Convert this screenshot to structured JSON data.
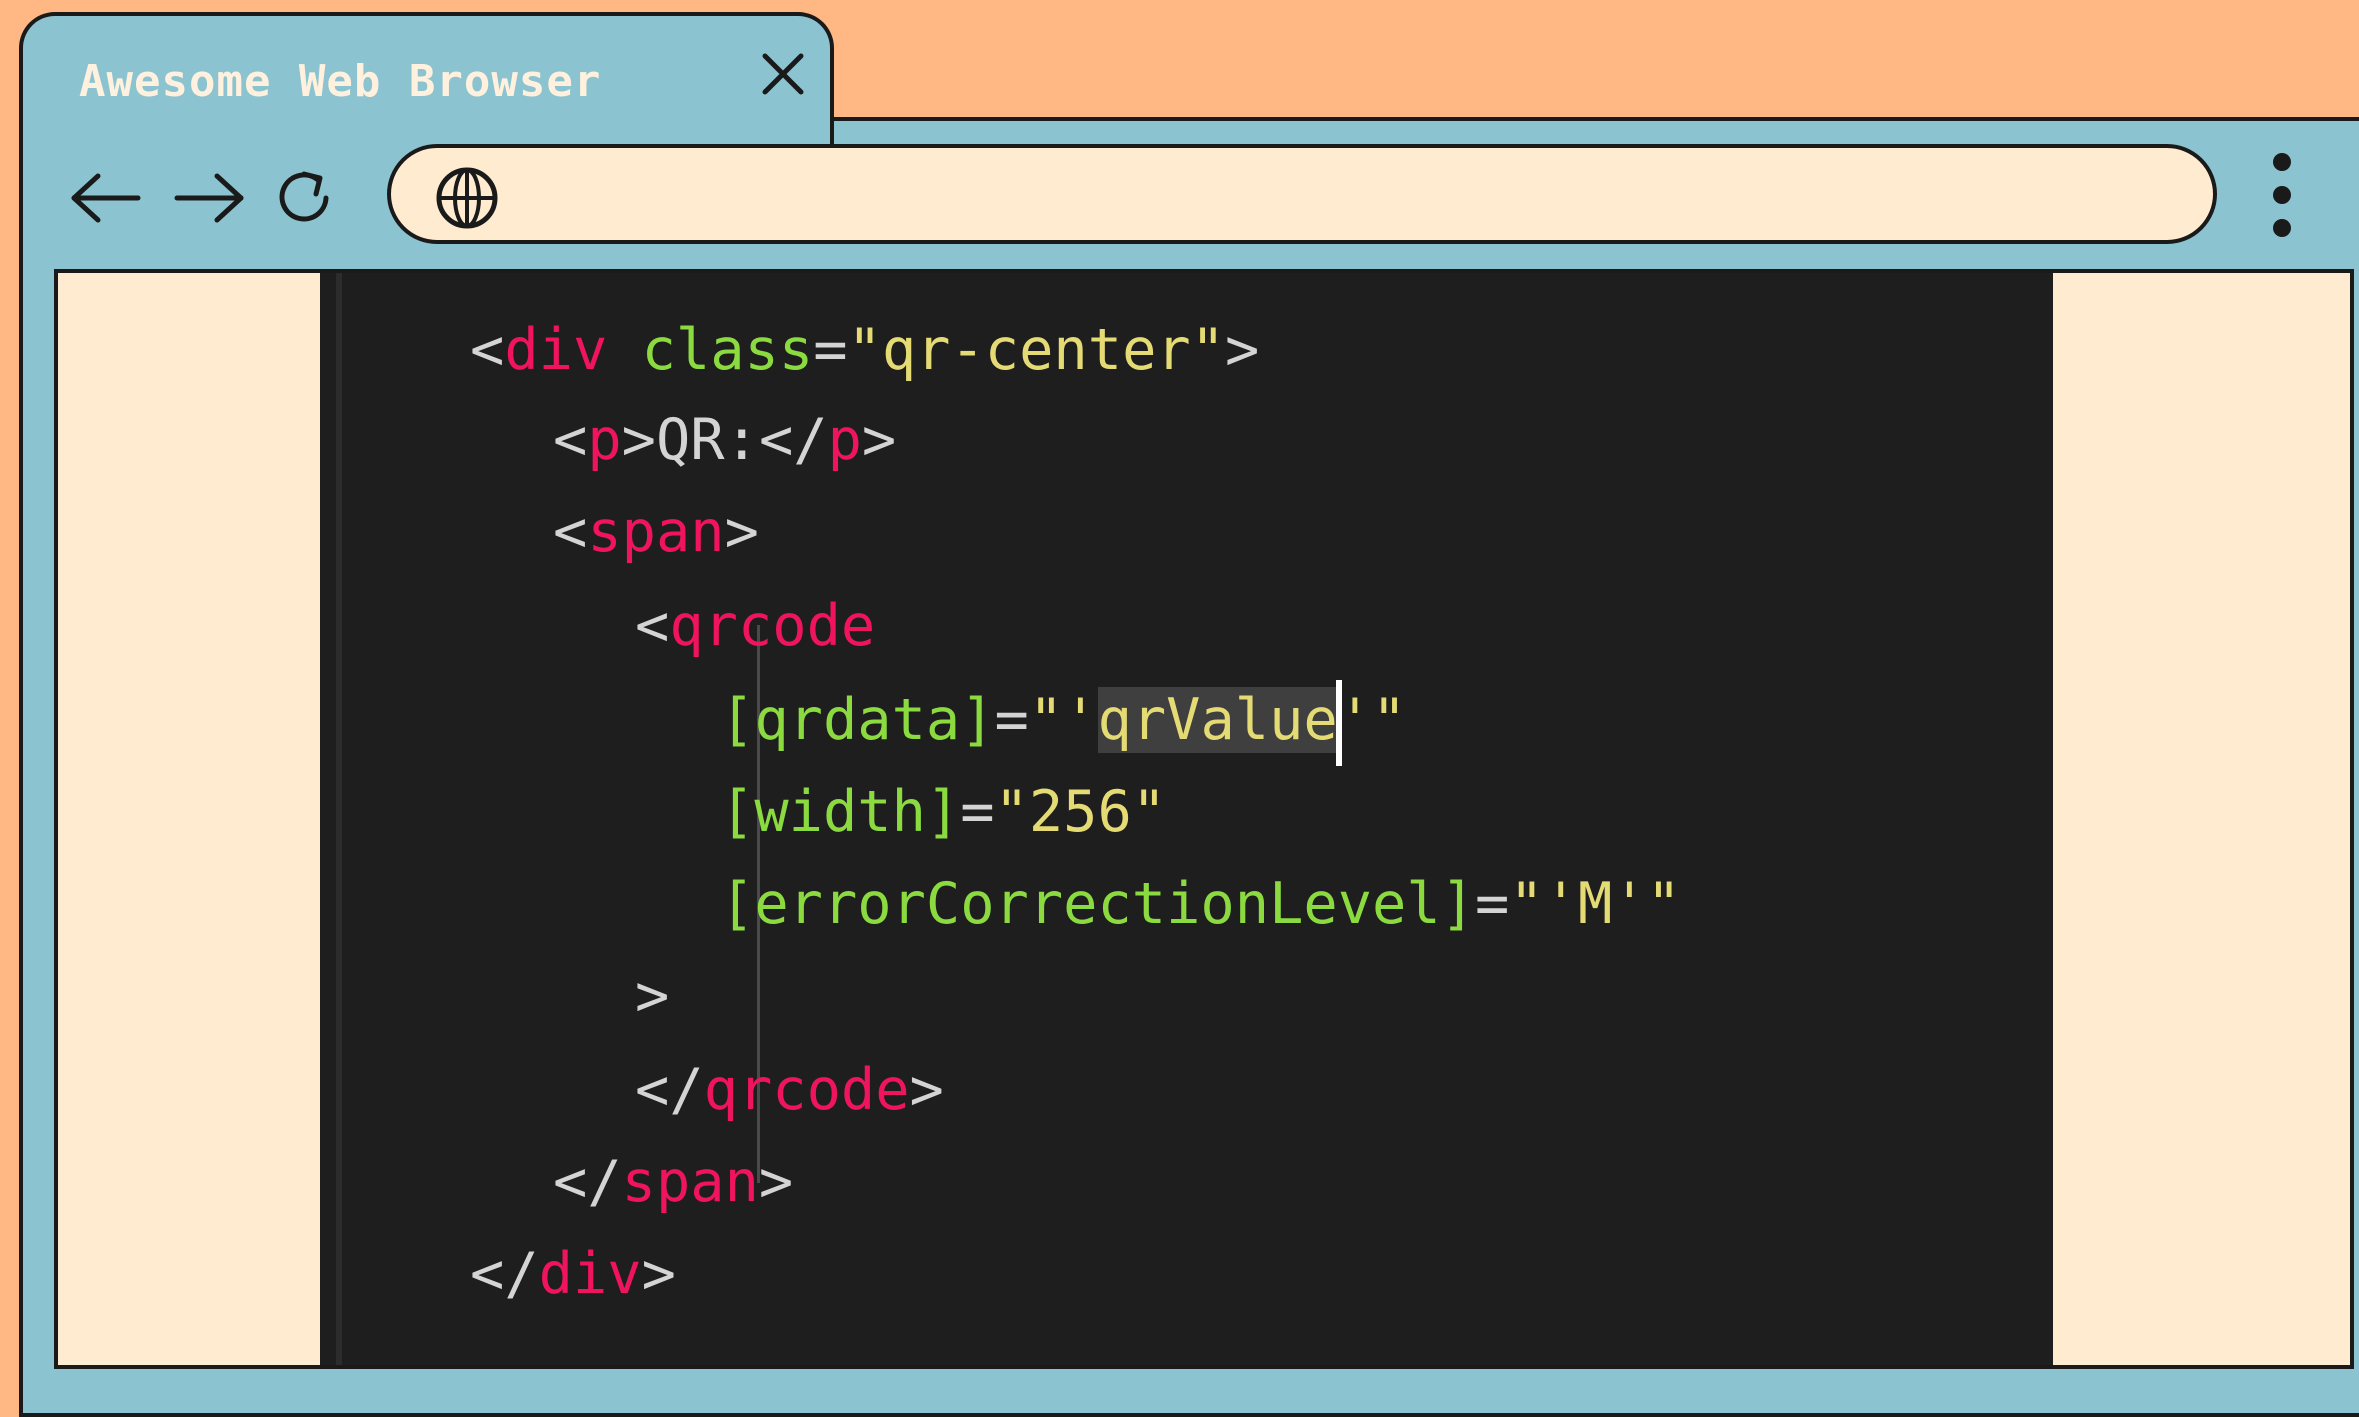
{
  "browser": {
    "tab_title": "Awesome Web Browser",
    "address_value": "",
    "icons": {
      "close": "close-icon",
      "back": "arrow-left-icon",
      "forward": "arrow-right-icon",
      "reload": "reload-icon",
      "globe": "globe-icon",
      "menu": "more-vertical-icon"
    }
  },
  "editor": {
    "lines": [
      {
        "parts": [
          [
            "<",
            "p"
          ],
          [
            "div",
            "t"
          ],
          [
            " ",
            "p"
          ],
          [
            "class",
            "a"
          ],
          [
            "=",
            "p"
          ],
          [
            "\"qr-center\"",
            "s"
          ],
          [
            ">",
            "p"
          ]
        ]
      },
      {
        "parts": [
          [
            "<",
            "p"
          ],
          [
            "p",
            "t"
          ],
          [
            ">",
            "p"
          ],
          [
            "QR:",
            "p"
          ],
          [
            "</",
            "p"
          ],
          [
            "p",
            "t"
          ],
          [
            ">",
            "p"
          ]
        ]
      },
      {
        "parts": [
          [
            "<",
            "p"
          ],
          [
            "span",
            "t"
          ],
          [
            ">",
            "p"
          ]
        ]
      },
      {
        "parts": [
          [
            "<",
            "p"
          ],
          [
            "qrcode",
            "t"
          ]
        ]
      },
      {
        "parts": [
          [
            "[qrdata]",
            "a"
          ],
          [
            "=",
            "p"
          ],
          [
            "\"'",
            "s"
          ],
          [
            "qrValue",
            "s hl"
          ],
          [
            "|cursor|",
            "cursor"
          ],
          [
            "'\"",
            "s"
          ]
        ]
      },
      {
        "parts": [
          [
            "[width]",
            "a"
          ],
          [
            "=",
            "p"
          ],
          [
            "\"256\"",
            "s"
          ]
        ]
      },
      {
        "parts": [
          [
            "[errorCorrectionLevel]",
            "a"
          ],
          [
            "=",
            "p"
          ],
          [
            "\"'M'\"",
            "s"
          ]
        ]
      },
      {
        "parts": [
          [
            ">",
            "p"
          ]
        ]
      },
      {
        "parts": [
          [
            "</",
            "p"
          ],
          [
            "qrcode",
            "t"
          ],
          [
            ">",
            "p"
          ]
        ]
      },
      {
        "parts": [
          [
            "</",
            "p"
          ],
          [
            "span",
            "t"
          ],
          [
            ">",
            "p"
          ]
        ]
      },
      {
        "parts": [
          [
            "</",
            "p"
          ],
          [
            "div",
            "t"
          ],
          [
            ">",
            "p"
          ]
        ]
      }
    ]
  }
}
